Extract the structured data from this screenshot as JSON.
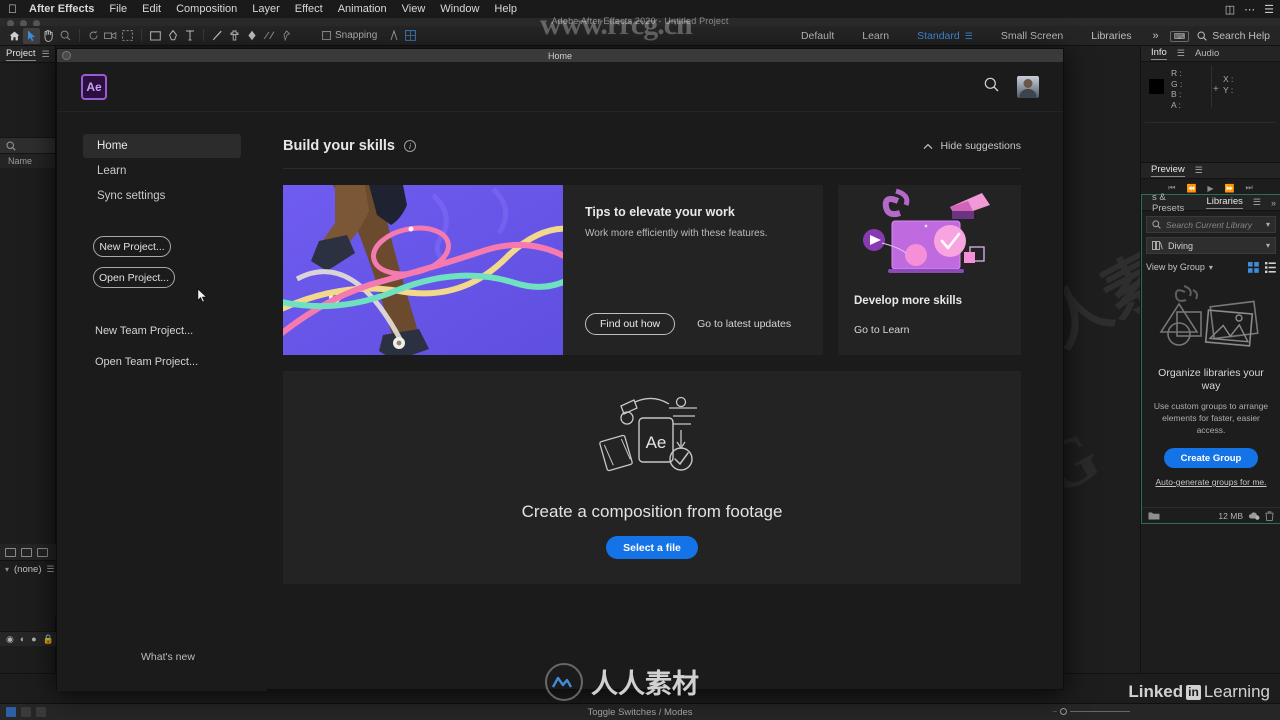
{
  "menubar": {
    "apple_icon": "apple-icon",
    "items": [
      {
        "label": "After Effects",
        "bold": true
      },
      {
        "label": "File",
        "bold": false
      },
      {
        "label": "Edit",
        "bold": false
      },
      {
        "label": "Composition",
        "bold": false
      },
      {
        "label": "Layer",
        "bold": false
      },
      {
        "label": "Effect",
        "bold": false
      },
      {
        "label": "Animation",
        "bold": false
      },
      {
        "label": "View",
        "bold": false
      },
      {
        "label": "Window",
        "bold": false
      },
      {
        "label": "Help",
        "bold": false
      }
    ]
  },
  "app": {
    "title": "Adobe After Effects 2020 - Untitled Project"
  },
  "toolbar": {
    "snapping_label": "Snapping",
    "tools": [
      "home-icon",
      "selection-tool-icon",
      "hand-tool-icon",
      "zoom-tool-icon",
      "rotation-tool-icon",
      "camera-tool-icon",
      "pan-behind-tool-icon",
      "shape-tool-icon",
      "pen-tool-icon",
      "text-tool-icon",
      "brush-tool-icon",
      "clone-stamp-tool-icon",
      "eraser-tool-icon",
      "roto-brush-tool-icon",
      "puppet-pin-tool-icon"
    ]
  },
  "workspaces": {
    "items": [
      {
        "label": "Default",
        "selected": false
      },
      {
        "label": "Learn",
        "selected": false
      },
      {
        "label": "Standard",
        "selected": true
      },
      {
        "label": "Small Screen",
        "selected": false
      },
      {
        "label": "Libraries",
        "selected": false
      }
    ],
    "overflow_label": "»",
    "search_placeholder": "Search Help"
  },
  "project_panel": {
    "tab_label": "Project",
    "menu_icon": "hamburger-icon",
    "search_icon": "search-icon",
    "column_name": "Name",
    "footer_value": "(none)"
  },
  "timeline": {
    "toggle_label": "Toggle Switches / Modes"
  },
  "home": {
    "window_title": "Home",
    "logo_text": "Ae",
    "search_icon": "search-icon",
    "avatar": "user-avatar",
    "nav": [
      {
        "label": "Home",
        "selected": true
      },
      {
        "label": "Learn",
        "selected": false
      },
      {
        "label": "Sync settings",
        "selected": false
      }
    ],
    "buttons": [
      {
        "label": "New Project..."
      },
      {
        "label": "Open Project..."
      }
    ],
    "team_links": [
      {
        "label": "New Team Project..."
      },
      {
        "label": "Open Team Project..."
      }
    ],
    "whats_new": "What's new",
    "section": {
      "title": "Build your skills",
      "info_icon": "info-icon",
      "hide_label": "Hide suggestions",
      "hide_icon": "chevron-up-icon"
    },
    "tips_card": {
      "heading": "Tips to elevate your work",
      "body": "Work more efficiently with these features.",
      "button_label": "Find out how",
      "link_label": "Go to latest updates",
      "hero_alt": "skateboarder-purple-ribbons"
    },
    "skills_card": {
      "heading": "Develop more skills",
      "link_label": "Go to Learn",
      "art_alt": "video-screen-illustration"
    },
    "dropzone": {
      "icon": "ae-footage-icon",
      "title": "Create a composition from footage",
      "button_label": "Select a file"
    }
  },
  "right_panel": {
    "tabs_top": [
      {
        "label": "Info",
        "selected": true
      },
      {
        "label": "Audio",
        "selected": false
      }
    ],
    "info": {
      "channels": [
        "R :",
        "G :",
        "B :",
        "A :"
      ],
      "coords": [
        "X :",
        "Y :"
      ]
    },
    "preview": {
      "label": "Preview",
      "menu_icon": "hamburger-icon",
      "controls": [
        "first-frame-icon",
        "prev-frame-icon",
        "play-icon",
        "next-frame-icon",
        "last-frame-icon"
      ]
    },
    "libraries": {
      "tab_effects": "s & Presets",
      "tab_libraries": "Libraries",
      "overflow": "»",
      "search_placeholder": "Search Current Library",
      "current_library": "Diving",
      "view_label": "View by Group",
      "grid_icon": "grid-view-icon",
      "list_icon": "list-view-icon",
      "empty_heading": "Organize libraries your way",
      "empty_body": "Use custom groups to arrange elements for faster, easier access.",
      "create_button": "Create Group",
      "auto_link": "Auto-generate groups for me.",
      "footer_size": "12 MB",
      "footer_icons": [
        "folder-icon",
        "cloud-sync-icon",
        "trash-icon"
      ]
    }
  },
  "watermarks": {
    "top_site": "www.rrcg.cn",
    "brand_latin": "RRCG",
    "brand_cn": "人人素材",
    "bottom_brand": "人人素材",
    "linkedin_a": "Linked",
    "linkedin_in": "in",
    "linkedin_b": "Learning"
  },
  "colors": {
    "accent_blue": "#1473e6",
    "workspace_selected": "#3f8cd8",
    "hero_purple": "#6a5ae8",
    "ae_purple": "#9a5cd0",
    "panel_bg": "#1d1d1d",
    "card_bg": "#232323"
  }
}
